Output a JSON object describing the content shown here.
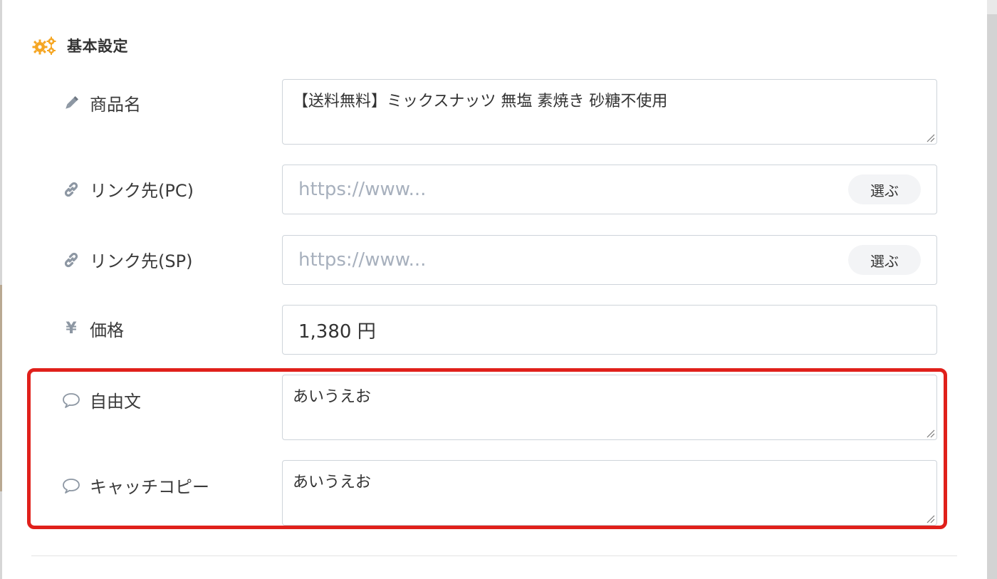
{
  "section": {
    "title": "基本設定",
    "icon": "gears-icon",
    "icon_color": "#f5a623"
  },
  "fields": {
    "product_name": {
      "label": "商品名",
      "icon": "pencil-icon",
      "value": "【送料無料】ミックスナッツ 無塩 素焼き 砂糖不使用"
    },
    "link_pc": {
      "label": "リンク先(PC)",
      "icon": "link-icon",
      "placeholder": "https://www...",
      "button_label": "選ぶ"
    },
    "link_sp": {
      "label": "リンク先(SP)",
      "icon": "link-icon",
      "placeholder": "https://www...",
      "button_label": "選ぶ"
    },
    "price": {
      "label": "価格",
      "icon": "yen-icon",
      "icon_glyph": "¥",
      "value": "1,380 円"
    },
    "free_text": {
      "label": "自由文",
      "icon": "speech-bubble-icon",
      "value": "あいうえお"
    },
    "catch_copy": {
      "label": "キャッチコピー",
      "icon": "speech-bubble-icon",
      "value": "あいうえお"
    }
  },
  "colors": {
    "highlight_border": "#e0201b",
    "icon_gray": "#8d97a3",
    "placeholder": "#a7b0bd"
  }
}
